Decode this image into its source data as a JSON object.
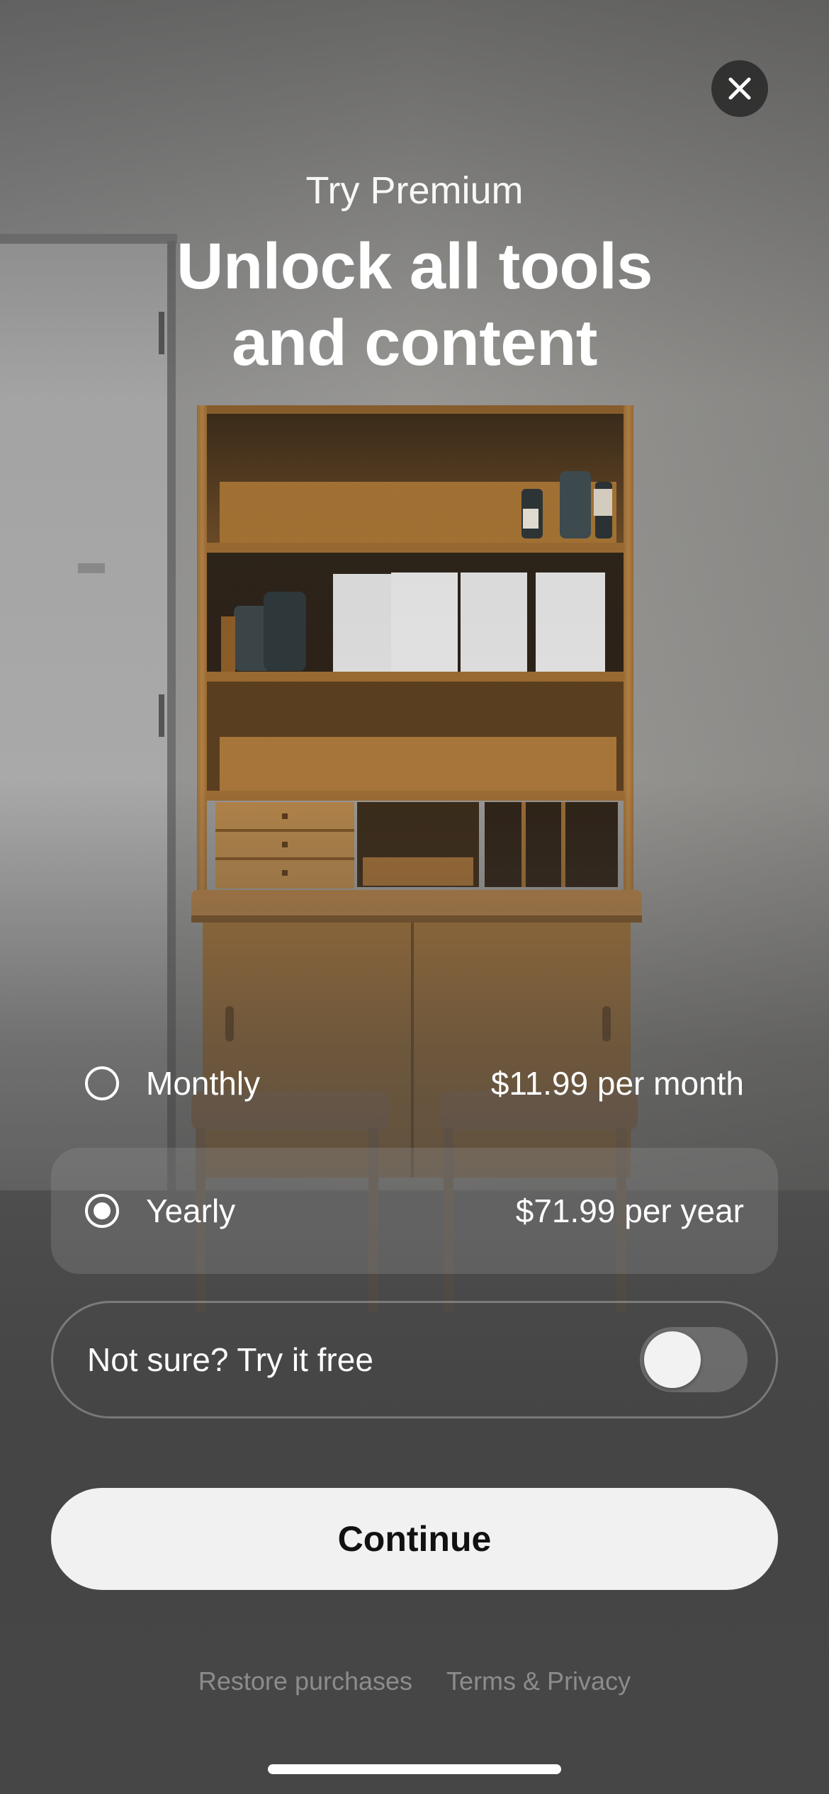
{
  "header": {
    "eyebrow": "Try Premium",
    "headline_line1": "Unlock all tools",
    "headline_line2": "and content"
  },
  "plans": [
    {
      "name": "Monthly",
      "price": "$11.99 per month",
      "selected": false
    },
    {
      "name": "Yearly",
      "price": "$71.99 per year",
      "selected": true
    }
  ],
  "trial": {
    "label": "Not sure? Try it free",
    "enabled": false
  },
  "actions": {
    "continue_label": "Continue"
  },
  "footer": {
    "restore_label": "Restore purchases",
    "terms_label": "Terms & Privacy"
  },
  "icons": {
    "close": "close-icon"
  },
  "colors": {
    "button_bg": "#f1f1f1",
    "button_text": "#111111",
    "wood": "#a8773d"
  }
}
